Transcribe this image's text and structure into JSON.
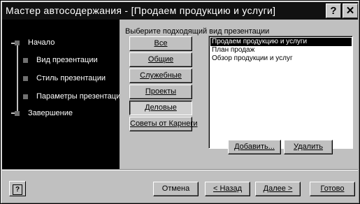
{
  "window": {
    "title": "Мастер автосодержания - [Продаем продукцию и услуги]",
    "help_glyph": "?",
    "close_glyph": "✕"
  },
  "steps": [
    {
      "label": "Начало"
    },
    {
      "label": "Вид презентации"
    },
    {
      "label": "Стиль презентации"
    },
    {
      "label": "Параметры презентации"
    },
    {
      "label": "Завершение"
    }
  ],
  "main": {
    "prompt": "Выберите подходящий вид презентации",
    "categories": [
      {
        "label": "Все"
      },
      {
        "label": "Общие"
      },
      {
        "label": "Служебные"
      },
      {
        "label": "Проекты"
      },
      {
        "label": "Деловые",
        "pressed": true
      },
      {
        "label": "Советы от Карнеги"
      }
    ],
    "presentations": [
      {
        "label": "Продаем продукцию и услуги",
        "selected": true
      },
      {
        "label": "План продаж"
      },
      {
        "label": "Обзор продукции и услуг"
      }
    ],
    "add_label": "Добавить...",
    "delete_label": "Удалить"
  },
  "footer": {
    "help_glyph": "?",
    "cancel_label": "Отмена",
    "back_label": "< Назад",
    "next_label": "Далее >",
    "finish_label": "Готово"
  }
}
